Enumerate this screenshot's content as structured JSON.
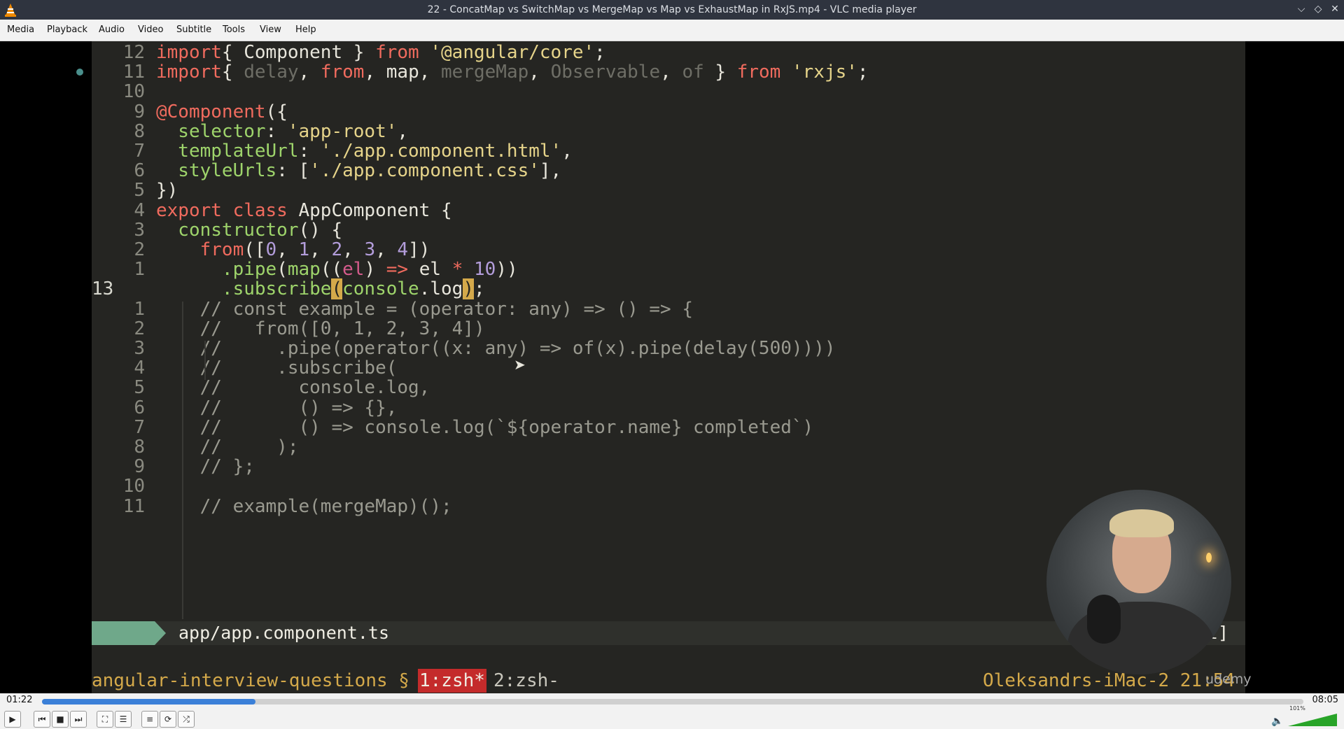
{
  "window": {
    "title": "22 - ConcatMap vs SwitchMap vs MergeMap vs Map vs ExhaustMap in RxJS.mp4 - VLC media player"
  },
  "menu": [
    "Media",
    "Playback",
    "Audio",
    "Video",
    "Subtitle",
    "Tools",
    "View",
    "Help"
  ],
  "editor": {
    "lines": [
      {
        "num": "12",
        "tokens": [
          [
            "k",
            "import"
          ],
          [
            "",
            "{ Component } "
          ],
          [
            "k",
            "from"
          ],
          [
            "",
            " "
          ],
          [
            "s",
            "'@angular/core'"
          ],
          [
            "",
            ";"
          ]
        ]
      },
      {
        "num": "11",
        "tokens": [
          [
            "k",
            "import"
          ],
          [
            "",
            "{ "
          ],
          [
            "dim",
            "delay"
          ],
          [
            "",
            ", "
          ],
          [
            "k",
            "from"
          ],
          [
            "",
            ", map, "
          ],
          [
            "dim",
            "mergeMap"
          ],
          [
            "",
            ", "
          ],
          [
            "dim",
            "Observable"
          ],
          [
            "",
            ", "
          ],
          [
            "dim",
            "of"
          ],
          [
            "",
            " } "
          ],
          [
            "k",
            "from"
          ],
          [
            "",
            " "
          ],
          [
            "s",
            "'rxjs'"
          ],
          [
            "",
            ";"
          ]
        ]
      },
      {
        "num": "10",
        "tokens": []
      },
      {
        "num": "9",
        "tokens": [
          [
            "k",
            "@Component"
          ],
          [
            "",
            "({"
          ]
        ]
      },
      {
        "num": "8",
        "tokens": [
          [
            "f",
            "  selector"
          ],
          [
            "",
            ": "
          ],
          [
            "s",
            "'app-root'"
          ],
          [
            "",
            ","
          ]
        ]
      },
      {
        "num": "7",
        "tokens": [
          [
            "f",
            "  templateUrl"
          ],
          [
            "",
            ": "
          ],
          [
            "s",
            "'./app.component.html'"
          ],
          [
            "",
            ","
          ]
        ]
      },
      {
        "num": "6",
        "tokens": [
          [
            "f",
            "  styleUrls"
          ],
          [
            "",
            ": ["
          ],
          [
            "s",
            "'./app.component.css'"
          ],
          [
            "",
            "],"
          ]
        ]
      },
      {
        "num": "5",
        "tokens": [
          [
            "",
            "})"
          ]
        ]
      },
      {
        "num": "4",
        "tokens": [
          [
            "k",
            "export class"
          ],
          [
            "",
            " AppComponent {"
          ]
        ]
      },
      {
        "num": "3",
        "tokens": [
          [
            "f",
            "  constructor"
          ],
          [
            "",
            "() {"
          ]
        ]
      },
      {
        "num": "2",
        "tokens": [
          [
            "k",
            "    from"
          ],
          [
            "",
            "(["
          ],
          [
            "n",
            "0"
          ],
          [
            "",
            ", "
          ],
          [
            "n",
            "1"
          ],
          [
            "",
            ", "
          ],
          [
            "n",
            "2"
          ],
          [
            "",
            ", "
          ],
          [
            "n",
            "3"
          ],
          [
            "",
            ", "
          ],
          [
            "n",
            "4"
          ],
          [
            "",
            "])"
          ]
        ]
      },
      {
        "num": "1",
        "tokens": [
          [
            "f",
            "      .pipe"
          ],
          [
            "",
            "("
          ],
          [
            "f",
            "map"
          ],
          [
            "",
            "(("
          ],
          [
            "mag",
            "el"
          ],
          [
            "",
            ") "
          ],
          [
            "k",
            "=>"
          ],
          [
            "",
            " el "
          ],
          [
            "k",
            "*"
          ],
          [
            "",
            " "
          ],
          [
            "n",
            "10"
          ],
          [
            "",
            "))"
          ]
        ]
      },
      {
        "num": "13",
        "tokens": [
          [
            "f",
            "      .subscribe"
          ],
          [
            "cur",
            "("
          ],
          [
            "f",
            "console"
          ],
          [
            "",
            ".log"
          ],
          [
            "cur",
            ")"
          ],
          [
            "",
            ";"
          ]
        ]
      },
      {
        "num": "1",
        "tokens": [
          [
            "c",
            "    // const example = (operator: any) => () => {"
          ]
        ]
      },
      {
        "num": "2",
        "tokens": [
          [
            "c",
            "    //   from([0, 1, 2, 3, 4])"
          ]
        ]
      },
      {
        "num": "3",
        "tokens": [
          [
            "c",
            "    //     .pipe(operator((x: any) => of(x).pipe(delay(500))))"
          ]
        ]
      },
      {
        "num": "4",
        "tokens": [
          [
            "c",
            "    //     .subscribe("
          ]
        ]
      },
      {
        "num": "5",
        "tokens": [
          [
            "c",
            "    //       console.log,"
          ]
        ]
      },
      {
        "num": "6",
        "tokens": [
          [
            "c",
            "    //       () => {},"
          ]
        ]
      },
      {
        "num": "7",
        "tokens": [
          [
            "c",
            "    //       () => console.log(`${operator.name} completed`)"
          ]
        ]
      },
      {
        "num": "8",
        "tokens": [
          [
            "c",
            "    //     );"
          ]
        ]
      },
      {
        "num": "9",
        "tokens": [
          [
            "c",
            "    // };"
          ]
        ]
      },
      {
        "num": "10",
        "tokens": []
      },
      {
        "num": "11",
        "tokens": [
          [
            "c",
            "    // example(mergeMap)();"
          ]
        ]
      }
    ],
    "status_filename": "app/app.component.ts",
    "status_filetype": "t]"
  },
  "tmux": {
    "session": "angular-interview-questions §",
    "window1": "1:zsh*",
    "window2": "2:zsh-",
    "host": "Oleksandrs-iMac-2 21:54"
  },
  "watermark": "udemy",
  "player": {
    "elapsed": "01:22",
    "total": "08:05",
    "progress": 0.169,
    "volume_label": "101%"
  },
  "colors": {
    "accent": "#3b80d8",
    "keyword": "#f06b5e",
    "string": "#e6d48a",
    "number": "#b39ddb",
    "function": "#9ed46b"
  },
  "icons": [
    "vlc-cone-icon",
    "minimize-icon",
    "restore-icon",
    "close-icon",
    "play-icon",
    "previous-icon",
    "stop-icon",
    "next-icon",
    "fullscreen-icon",
    "extended-settings-icon",
    "playlist-icon",
    "loop-icon",
    "shuffle-icon",
    "speaker-icon"
  ]
}
